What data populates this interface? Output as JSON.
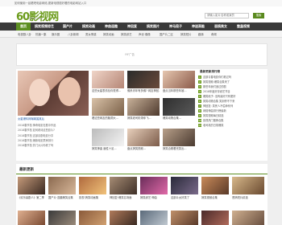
{
  "topbar": {
    "text": "如何使用一起看吧电影网络,更新电视剧好看的电影网站入口"
  },
  "header": {
    "logo_text": "60影视网",
    "logo_sub": "360vv.com"
  },
  "search": {
    "placeholder": "请输入影片名称或演员",
    "button_label": "搜索"
  },
  "nav": {
    "items": [
      "首页",
      "搞笑视频综艺",
      "国产片",
      "搞笑动画",
      "神曲逗趣",
      "神回复",
      "搞笑图片",
      "神马段子",
      "神迷高能",
      "恶搞美女",
      "整蛊视频"
    ]
  },
  "subnav": {
    "items": [
      "电视剧八卦",
      "热播一集",
      "娱乐圈",
      "八卦新闻",
      "男女情感",
      "搞笑动画",
      "搞笑综艺",
      "声优·偶像",
      "国产片二区",
      "搞笑短片",
      "趣事",
      "奇闻"
    ]
  },
  "banner": {
    "text": "IYF广告"
  },
  "main": {
    "featured_caption": "女星爆料网曝离婚某后",
    "thumbs": [
      {
        "caption": "这些女星表情包你觉得..."
      },
      {
        "caption": "佛系青年有多佛? 网友神回..."
      },
      {
        "caption": "盘点当年那些年被..."
      },
      {
        "caption": "看这些网友的脑洞大..."
      },
      {
        "caption": "搞笑老司机带你飞..."
      },
      {
        "caption": "爆笑动物合集..."
      },
      {
        "caption": "搞笑神曲 魔性十足..."
      },
      {
        "caption": "盘点搞笑视频..."
      },
      {
        "caption": "搞笑合辑看完笑出..."
      },
      {
        "caption": "神回复大全..."
      },
      {
        "caption": "神回复一句就..."
      },
      {
        "caption": "爆笑综艺名场面..."
      }
    ],
    "news": [
      "2018春节档 神奇电影在剧中作品",
      "2018春节档 如何看待这些影片?",
      "2018春节档 这部喜剧电影分享",
      "2018春节档 爆款电影票房排行",
      "2018春节档 热门大片你看了吗"
    ]
  },
  "hot": {
    "title": "最新更新排行榜",
    "items": [
      "这部青春电影你们看过吗",
      "搞笑视频:爆笑合集来了",
      "那些年我们追过的剧",
      "2018年度好评综艺节目",
      "爆笑段子: 没有最好只有更好",
      "搞笑动物合集 笑到停不下来",
      "神回复: 笑死人不偿命系列",
      "网络神曲排行榜最新",
      "搞笑视频每日精选",
      "影视热门推荐合集",
      "老司机的日常爆笑"
    ]
  },
  "latest": {
    "title": "最新更新",
    "items": [
      {
        "caption": "《欢乐喜剧人》第二季"
      },
      {
        "caption": "国产片·逗趣爆笑合集"
      },
      {
        "caption": "影视·搞笑动画集"
      },
      {
        "caption": "神回复·爆笑名场面"
      },
      {
        "caption": "搞笑综艺·神曲"
      },
      {
        "caption": "这部片太好笑了"
      },
      {
        "caption": "搞笑视频合集"
      },
      {
        "caption": "恶搞短片精选"
      }
    ]
  }
}
